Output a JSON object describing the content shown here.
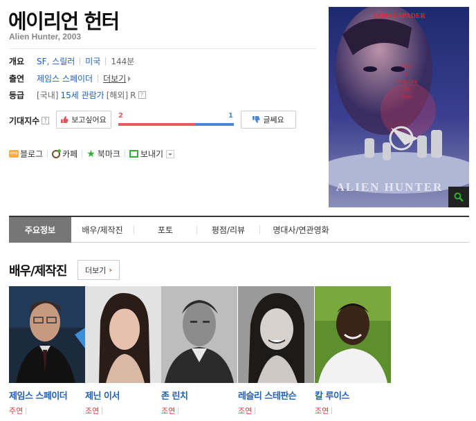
{
  "movie": {
    "title": "에이리언 헌터",
    "subtitle": "Alien Hunter, 2003"
  },
  "overview": {
    "label": "개요",
    "genre": "SF, 스릴러",
    "country": "미국",
    "runtime": "144분"
  },
  "cast_info": {
    "label": "출연",
    "actor": "제임스 스페이더",
    "more": "더보기"
  },
  "rating": {
    "label": "등급",
    "domestic_prefix": "[국내]",
    "domestic": "15세 관람가",
    "overseas_prefix": "[해외]",
    "overseas": "R",
    "help": "?"
  },
  "anticipation": {
    "label": "기대지수",
    "help": "?",
    "want_label": "보고싶어요",
    "want_count": "2",
    "meh_label": "글쎄요",
    "meh_count": "1",
    "want_fraction": 0.667,
    "want_color": "#ea5b60",
    "meh_color": "#4a86d6"
  },
  "share": {
    "blog": "블로그",
    "blog_icon_text": "blog",
    "cafe": "카페",
    "bookmark": "북마크",
    "send": "보내기"
  },
  "poster": {
    "top_text": "JAMES SPADER",
    "tagline": [
      "There",
      "is",
      "Something",
      "Out",
      "There"
    ],
    "bottom_text": "ALIEN HUNTER"
  },
  "tabs": [
    {
      "label": "주요정보",
      "active": true
    },
    {
      "label": "배우/제작진",
      "active": false
    },
    {
      "label": "포토",
      "active": false
    },
    {
      "label": "평점/리뷰",
      "active": false
    },
    {
      "label": "명대사/연관영화",
      "active": false
    }
  ],
  "cast_section": {
    "title": "배우/제작진",
    "more": "더보기",
    "members": [
      {
        "name": "제임스 스페이더",
        "role": "주연",
        "icon": "portrait-man-glasses"
      },
      {
        "name": "제닌 이서",
        "role": "조연",
        "icon": "portrait-woman-brunette"
      },
      {
        "name": "존 린치",
        "role": "조연",
        "icon": "portrait-man-bw"
      },
      {
        "name": "레슬리 스테판슨",
        "role": "조연",
        "icon": "portrait-woman-smiling"
      },
      {
        "name": "칼 루이스",
        "role": "조연",
        "icon": "portrait-man-smiling"
      }
    ]
  },
  "colors": {
    "link": "#1f5fb6",
    "role": "#d93a3a",
    "tab_active": "#767676"
  }
}
